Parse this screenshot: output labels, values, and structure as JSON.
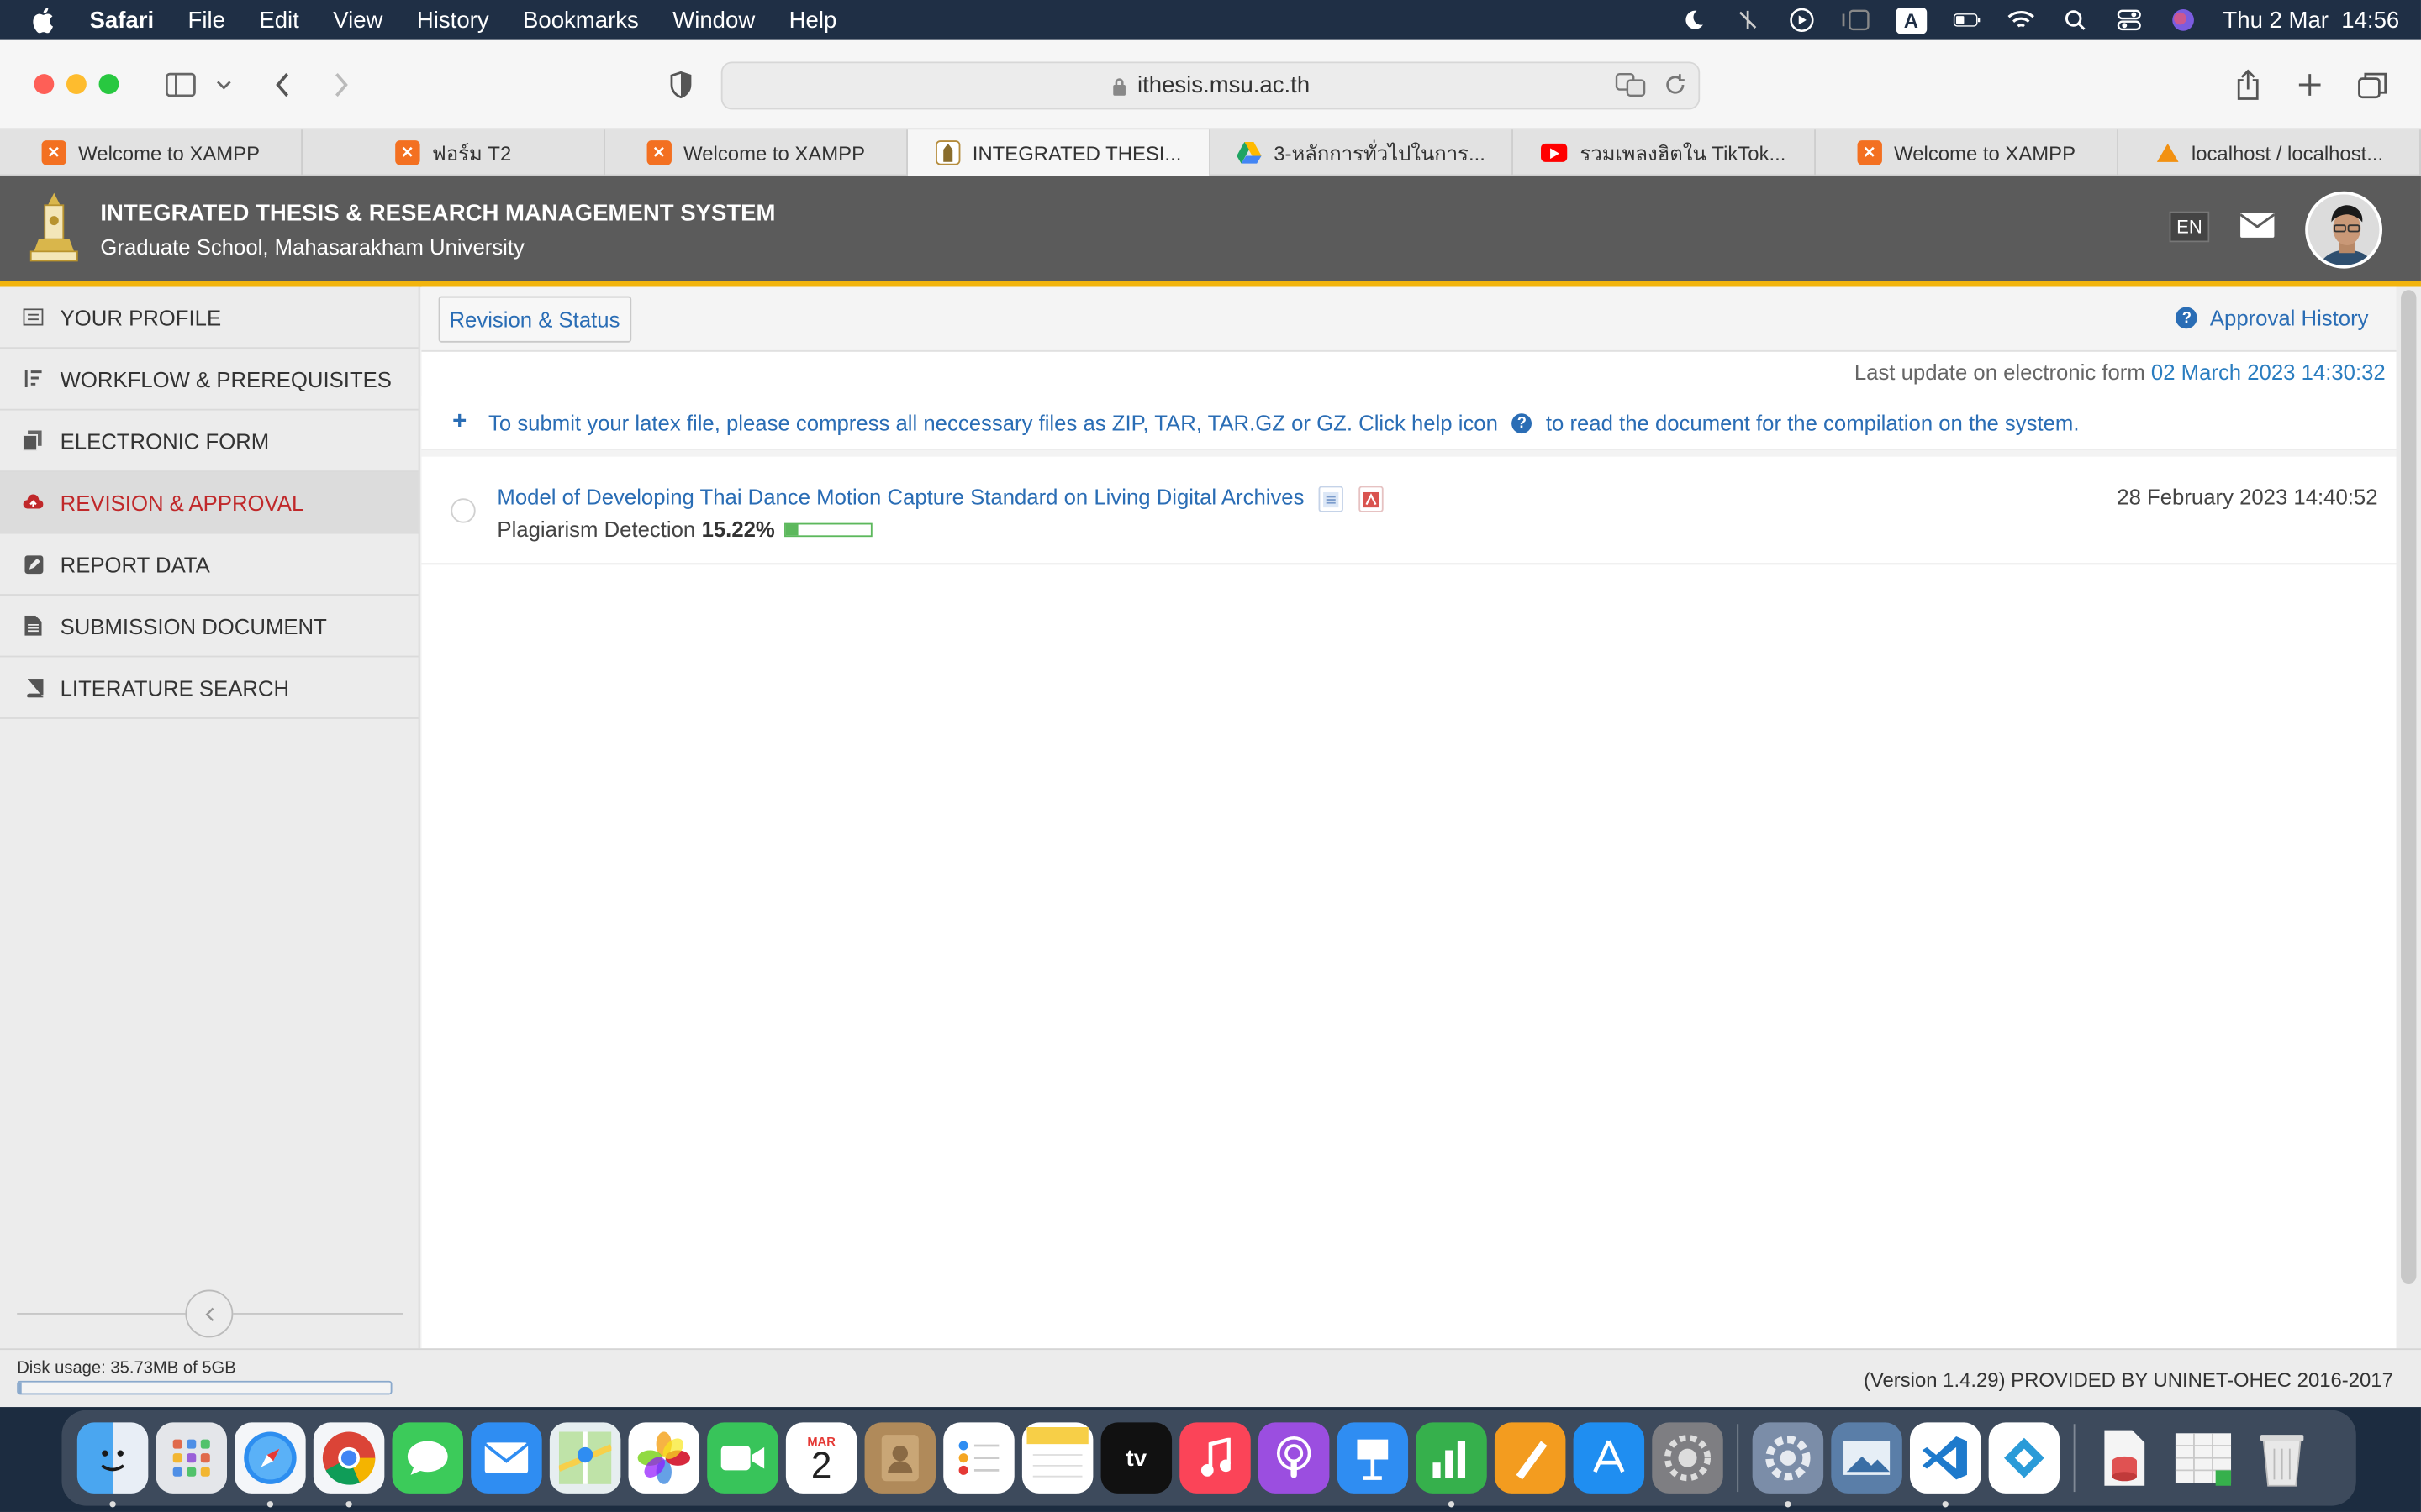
{
  "menubar": {
    "app": "Safari",
    "items": [
      "File",
      "Edit",
      "View",
      "History",
      "Bookmarks",
      "Window",
      "Help"
    ],
    "clock": "Thu 2 Mar  14:56",
    "input_badge": "A"
  },
  "browser": {
    "url": "ithesis.msu.ac.th",
    "tabs": [
      {
        "label": "Welcome to XAMPP",
        "fav": "xampp",
        "color": "#f37021"
      },
      {
        "label": "ฟอร์ม T2",
        "fav": "xampp",
        "color": "#f37021"
      },
      {
        "label": "Welcome to XAMPP",
        "fav": "xampp",
        "color": "#f37021"
      },
      {
        "label": "INTEGRATED THESI...",
        "fav": "msu",
        "color": "#8a6d2c",
        "active": true
      },
      {
        "label": "3-หลักการทั่วไปในการ...",
        "fav": "drive",
        "color": "#1fa463"
      },
      {
        "label": "รวมเพลงฮิตใน TikTok...",
        "fav": "youtube",
        "color": "#ff0000"
      },
      {
        "label": "Welcome to XAMPP",
        "fav": "xampp",
        "color": "#f37021"
      },
      {
        "label": "localhost / localhost...",
        "fav": "pma",
        "color": "#f29111"
      }
    ]
  },
  "header": {
    "title": "INTEGRATED THESIS & RESEARCH MANAGEMENT SYSTEM",
    "subtitle": "Graduate School, Mahasarakham University",
    "lang": "EN"
  },
  "sidebar": {
    "items": [
      {
        "label": "YOUR PROFILE",
        "icon": "id-card-icon"
      },
      {
        "label": "WORKFLOW & PREREQUISITES",
        "icon": "list-ordered-icon"
      },
      {
        "label": "ELECTRONIC FORM",
        "icon": "files-icon"
      },
      {
        "label": "REVISION & APPROVAL",
        "icon": "cloud-upload-icon",
        "active": true
      },
      {
        "label": "REPORT DATA",
        "icon": "edit-square-icon"
      },
      {
        "label": "SUBMISSION DOCUMENT",
        "icon": "document-icon"
      },
      {
        "label": "LITERATURE SEARCH",
        "icon": "book-icon"
      }
    ]
  },
  "content": {
    "tab_button": "Revision & Status",
    "approval_history": "Approval History",
    "last_update_label": "Last update on electronic form",
    "last_update_value": "02 March 2023 14:30:32",
    "notice_part1": "To submit your latex file, please compress all neccessary files as ZIP, TAR, TAR.GZ or GZ. Click help icon",
    "notice_part2": "to read the document for the compilation on the system.",
    "document": {
      "title": "Model of Developing Thai Dance Motion Capture Standard on Living Digital Archives",
      "plagiarism_label": "Plagiarism Detection",
      "plagiarism_value": "15.22%",
      "plagiarism_fraction": 0.1522,
      "date": "28 February 2023 14:40:52"
    }
  },
  "footer": {
    "disk_usage": "Disk usage: 35.73MB of 5GB",
    "disk_fraction": 0.007,
    "version": "(Version 1.4.29) PROVIDED BY UNINET-OHEC 2016-2017"
  },
  "dock": {
    "calendar_month": "MAR",
    "calendar_day": "2",
    "tv_label": "tv"
  }
}
